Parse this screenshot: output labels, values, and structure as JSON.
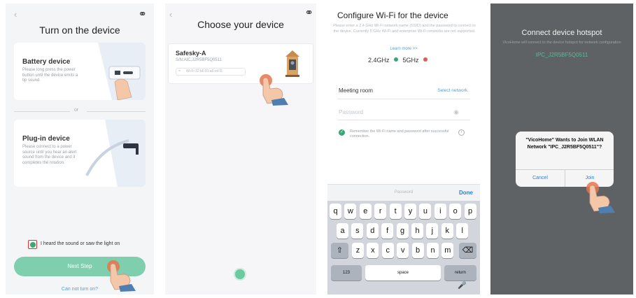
{
  "colors": {
    "accent_green": "#3aa876",
    "button_green": "#7fcfae",
    "link_blue": "#4fa3d6",
    "wifi_24_dot": "#3aa876",
    "wifi_5_dot": "#e05a4f",
    "overlay": "#5f6265"
  },
  "screen1": {
    "back_icon": "chevron-left-icon",
    "help_icon": "headset-icon",
    "title": "Turn on the device",
    "battery": {
      "title": "Battery device",
      "desc": "Please long press the power button until the device emits a tip sound."
    },
    "or": "or",
    "plugin": {
      "title": "Plug-in device",
      "desc": "Please connect to a power source until you hear an alert sound from the device and it completes the rotation."
    },
    "checkbox_label": "I heard the sound or saw the light on",
    "checkbox_checked": true,
    "next_button": "Next Step",
    "cannot_turn_on": "Can not turn on?"
  },
  "screen2": {
    "back_icon": "chevron-left-icon",
    "help_icon": "headset-icon",
    "title": "Choose your device",
    "device": {
      "name": "Safesky-A",
      "sn": "S/N:AIC,J2R5BF5Q0511",
      "wifi": "Wi-Fi:32:b6:81:a6:cd:f3"
    }
  },
  "screen3": {
    "title": "Configure Wi-Fi for the device",
    "desc": "Please enter a 2.4 GHz Wi-Fi network name (SSID) and the password to connect to the device. Currently 5 GHz Wi-Fi and enterprise Wi-Fi networks are not supported.",
    "learn_more": "Learn more >>",
    "band_24": "2.4GHz",
    "band_5": "5GHz",
    "network_value": "Meeting room",
    "select_network": "Select network",
    "password_placeholder": "Password",
    "remember_text": "Remember the Wi-Fi name and password after successful connection.",
    "keyboard": {
      "field_label": "Password",
      "done": "Done",
      "row1": [
        "q",
        "w",
        "e",
        "r",
        "t",
        "y",
        "u",
        "i",
        "o",
        "p"
      ],
      "row2": [
        "a",
        "s",
        "d",
        "f",
        "g",
        "h",
        "j",
        "k",
        "l"
      ],
      "row3": [
        "z",
        "x",
        "c",
        "v",
        "b",
        "n",
        "m"
      ],
      "shift_icon": "shift-icon",
      "delete_icon": "delete-icon",
      "numbers": "123",
      "space": "space",
      "return": "return",
      "mic_icon": "microphone-icon"
    }
  },
  "screen4": {
    "title": "Connect device hotspot",
    "desc": "VicoHome will connect to the device hotspot for network configuration",
    "ssid": "IPC_J2R5BF5Q0511",
    "dialog": {
      "message": "\"VicoHome\" Wants to Join WLAN Network \"IPC_J2R5BF5Q0511\"?",
      "cancel": "Cancel",
      "join": "Join"
    }
  }
}
